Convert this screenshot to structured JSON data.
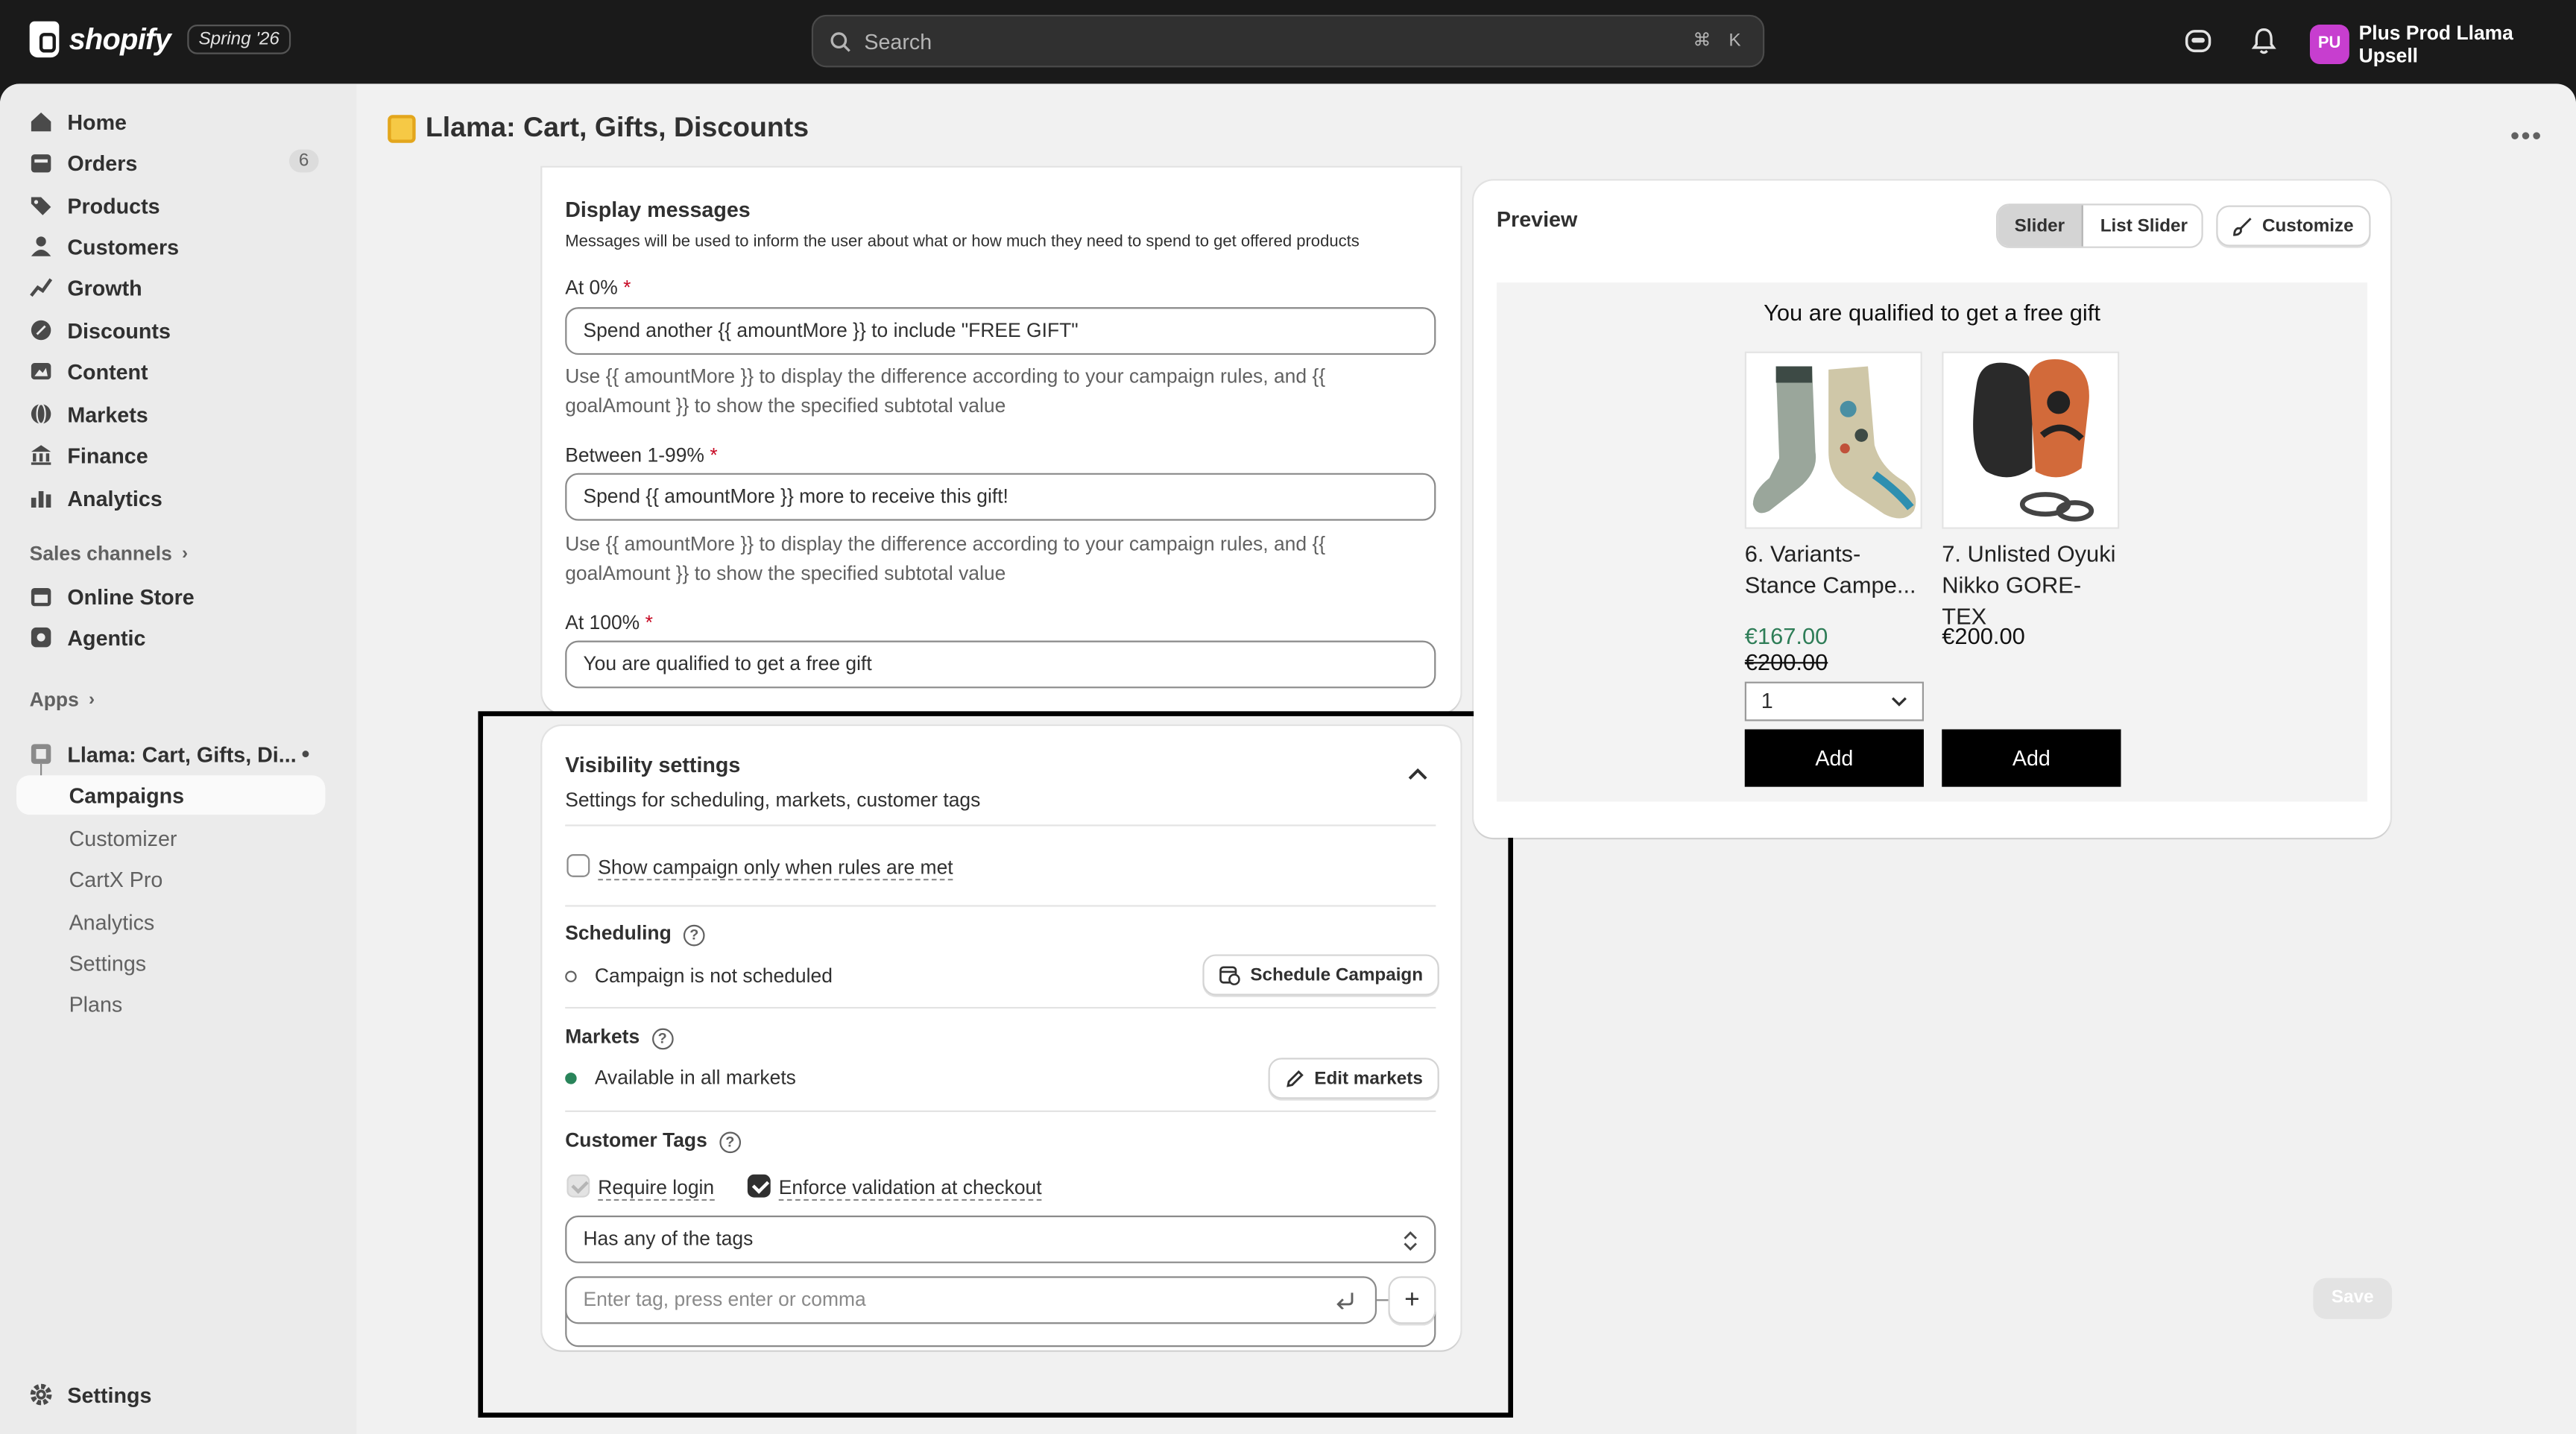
{
  "topbar": {
    "brand": "shopify",
    "edition": "Spring '26",
    "search_placeholder": "Search",
    "shortcut_cmd": "⌘",
    "shortcut_key": "K",
    "store_initials": "PU",
    "store_name": "Plus Prod Llama Upsell"
  },
  "sidebar": {
    "items": [
      {
        "label": "Home"
      },
      {
        "label": "Orders",
        "badge": "6"
      },
      {
        "label": "Products"
      },
      {
        "label": "Customers"
      },
      {
        "label": "Growth"
      },
      {
        "label": "Discounts"
      },
      {
        "label": "Content"
      },
      {
        "label": "Markets"
      },
      {
        "label": "Finance"
      },
      {
        "label": "Analytics"
      }
    ],
    "sales_channels_heading": "Sales channels",
    "channels": [
      {
        "label": "Online Store"
      },
      {
        "label": "Agentic"
      }
    ],
    "apps_heading": "Apps",
    "app_name": "Llama: Cart, Gifts, Di...",
    "app_subitems": [
      "Campaigns",
      "Customizer",
      "CartX Pro",
      "Analytics",
      "Settings",
      "Plans"
    ],
    "settings_label": "Settings"
  },
  "page": {
    "title": "Llama: Cart, Gifts, Discounts"
  },
  "display_messages": {
    "title": "Display messages",
    "subtitle": "Messages will be used to inform the user about what or how much they need to spend to get offered products",
    "fields": [
      {
        "label": "At 0%",
        "value": "Spend another {{ amountMore }} to include \"FREE GIFT\"",
        "help_1": "Use {{ amountMore }} to display the difference according to your campaign rules, and {{",
        "help_2": "goalAmount }} to show the specified subtotal value"
      },
      {
        "label": "Between 1-99%",
        "value": "Spend {{ amountMore }} more to receive this gift!",
        "help_1": "Use {{ amountMore }} to display the difference according to your campaign rules, and {{",
        "help_2": "goalAmount }} to show the specified subtotal value"
      },
      {
        "label": "At 100%",
        "value": "You are qualified to get a free gift"
      }
    ],
    "required_mark": "*"
  },
  "visibility": {
    "title": "Visibility settings",
    "subtitle": "Settings for scheduling, markets, customer tags",
    "show_when_rules_met": "Show campaign only when rules are met",
    "scheduling_heading": "Scheduling",
    "scheduling_status": "Campaign is not scheduled",
    "schedule_button": "Schedule Campaign",
    "markets_heading": "Markets",
    "markets_status": "Available in all markets",
    "edit_markets_button": "Edit markets",
    "customer_tags_heading": "Customer Tags",
    "require_login": "Require login",
    "enforce_validation": "Enforce validation at checkout",
    "tag_match_select": "Has any of the tags",
    "tag_input_placeholder": "Enter tag, press enter or comma",
    "add_tag_symbol": "+"
  },
  "preview": {
    "title": "Preview",
    "tabs": [
      "Slider",
      "List Slider"
    ],
    "active_tab": "Slider",
    "customize_button": "Customize",
    "headline": "You are qualified to get a free gift",
    "products": [
      {
        "name_1": "6. Variants-",
        "name_2": "Stance Campe...",
        "sale_price": "€167.00",
        "compare_price": "€200.00",
        "quantity": "1",
        "add_label": "Add"
      },
      {
        "name_1": "7. Unlisted Oyuki",
        "name_2": "Nikko GORE-TEX",
        "price": "€200.00",
        "add_label": "Add"
      }
    ]
  },
  "save_label": "Save",
  "colors": {
    "topbar": "#1a1a1a",
    "sale_price": "#2e7d57",
    "market_dot": "#29845a",
    "store_avatar": "#c73ecf",
    "app_icon": "#f6c945"
  }
}
